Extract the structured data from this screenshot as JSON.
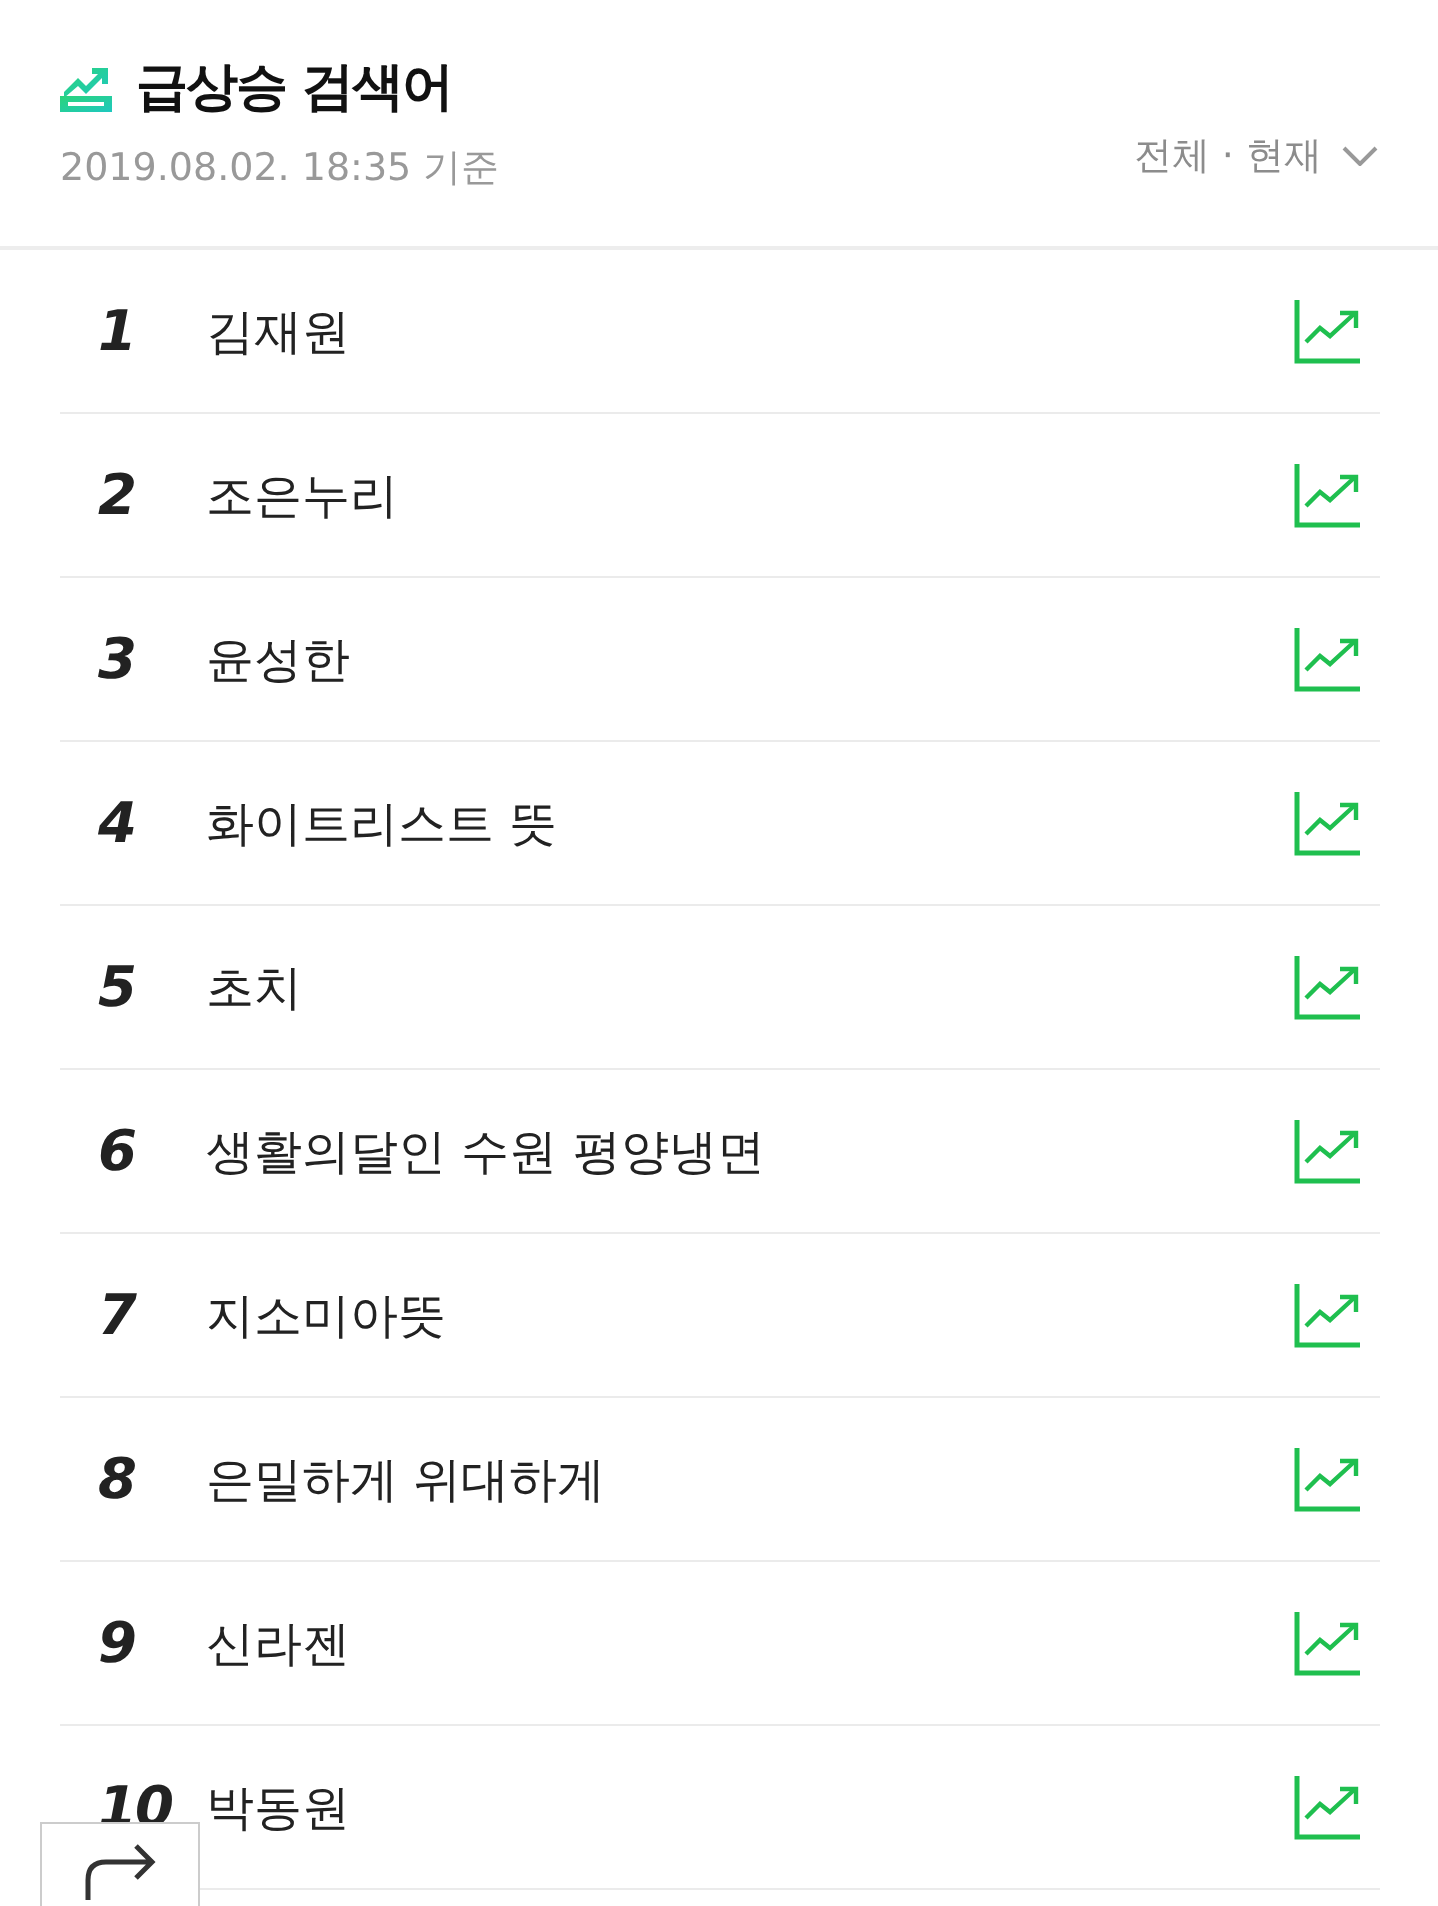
{
  "header": {
    "title": "급상승 검색어",
    "timestamp": "2019.08.02. 18:35 기준",
    "filter": "전체 · 현재"
  },
  "rows": [
    {
      "rank": "1",
      "keyword": "김재원"
    },
    {
      "rank": "2",
      "keyword": "조은누리"
    },
    {
      "rank": "3",
      "keyword": "윤성한"
    },
    {
      "rank": "4",
      "keyword": "화이트리스트 뜻"
    },
    {
      "rank": "5",
      "keyword": "초치"
    },
    {
      "rank": "6",
      "keyword": "생활의달인 수원 평양냉면"
    },
    {
      "rank": "7",
      "keyword": "지소미아뜻"
    },
    {
      "rank": "8",
      "keyword": "은밀하게 위대하게"
    },
    {
      "rank": "9",
      "keyword": "신라젠"
    },
    {
      "rank": "10",
      "keyword": "박동원"
    }
  ]
}
